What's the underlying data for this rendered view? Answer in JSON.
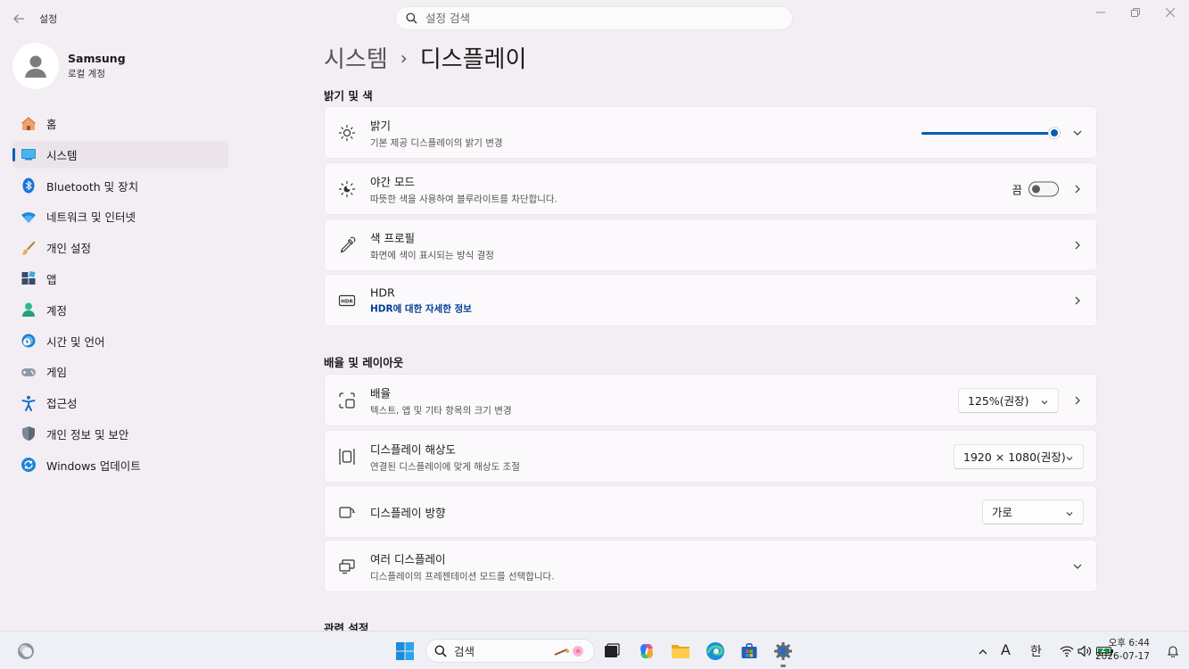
{
  "window": {
    "title": "설정",
    "search_placeholder": "설정 검색"
  },
  "profile": {
    "name": "Samsung",
    "account_type": "로컬 계정"
  },
  "nav": {
    "items": [
      {
        "label": "홈",
        "icon": "home-icon"
      },
      {
        "label": "시스템",
        "icon": "system-icon",
        "active": true
      },
      {
        "label": "Bluetooth 및 장치",
        "icon": "bluetooth-icon"
      },
      {
        "label": "네트워크 및 인터넷",
        "icon": "wifi-icon"
      },
      {
        "label": "개인 설정",
        "icon": "brush-icon"
      },
      {
        "label": "앱",
        "icon": "apps-icon"
      },
      {
        "label": "계정",
        "icon": "account-icon"
      },
      {
        "label": "시간 및 언어",
        "icon": "globe-clock-icon"
      },
      {
        "label": "게임",
        "icon": "gamepad-icon"
      },
      {
        "label": "접근성",
        "icon": "accessibility-icon"
      },
      {
        "label": "개인 정보 및 보안",
        "icon": "shield-icon"
      },
      {
        "label": "Windows 업데이트",
        "icon": "update-icon"
      }
    ]
  },
  "breadcrumb": {
    "parent": "시스템",
    "separator": "›",
    "current": "디스플레이"
  },
  "sections": {
    "brightness_color": "밝기 및 색",
    "scale_layout": "배율 및 레이아웃",
    "related": "관련 설정"
  },
  "settings": {
    "brightness": {
      "title": "밝기",
      "subtitle": "기본 제공 디스플레이의 밝기 변경",
      "level_percent": 100
    },
    "night_light": {
      "title": "야간 모드",
      "subtitle": "따뜻한 색을 사용하여 블루라이트를 차단합니다.",
      "state_label": "끔"
    },
    "color_profile": {
      "title": "색 프로필",
      "subtitle": "화면에 색이 표시되는 방식 결정"
    },
    "hdr": {
      "title": "HDR",
      "link": "HDR에 대한 자세한 정보"
    },
    "scale": {
      "title": "배율",
      "subtitle": "텍스트, 앱 및 기타 항목의 크기 변경",
      "value": "125%(권장)"
    },
    "resolution": {
      "title": "디스플레이 해상도",
      "subtitle": "연결된 디스플레이에 맞게 해상도 조절",
      "value": "1920 × 1080(권장)"
    },
    "orientation": {
      "title": "디스플레이 방향",
      "value": "가로"
    },
    "multiple": {
      "title": "여러 디스플레이",
      "subtitle": "디스플레이의 프레젠테이션 모드를 선택합니다."
    }
  },
  "taskbar": {
    "search_label": "검색",
    "ime_a": "A",
    "ime_han": "한",
    "time": "오후 6:44",
    "date": "2026-07-17"
  },
  "colors": {
    "accent": "#005fb8",
    "background": "#f3eef3",
    "card": "#fbf9fb"
  }
}
